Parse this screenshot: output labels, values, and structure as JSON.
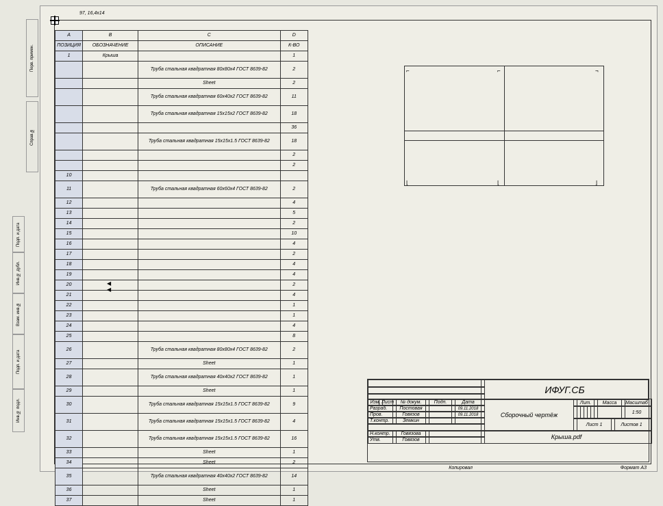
{
  "dim_label": "97, 16,4x14",
  "columns": {
    "a": "A",
    "b": "B",
    "c": "C",
    "d": "D"
  },
  "headers": {
    "poz": "ПОЗИЦИЯ",
    "oboz": "ОБОЗНАЧЕНИЕ",
    "desc": "ОПИСАНИЕ",
    "qty": "К-ВО"
  },
  "rows": [
    {
      "n": "1",
      "b": "Крыша",
      "c": "",
      "d": "1"
    },
    {
      "n": "",
      "b": "",
      "c": "Труба стальная квадратная 80х80х4 ГОСТ 8639-82",
      "d": "2"
    },
    {
      "n": "",
      "b": "",
      "c": "Sheet",
      "d": "2"
    },
    {
      "n": "",
      "b": "",
      "c": "Труба стальная квадратная 60х40х2 ГОСТ 8639-82",
      "d": "11"
    },
    {
      "n": "",
      "b": "",
      "c": "Труба стальная квадратная 15х15х2 ГОСТ 8639-82",
      "d": "18"
    },
    {
      "n": "",
      "b": "",
      "c": "",
      "d": "36"
    },
    {
      "n": "",
      "b": "",
      "c": "Труба стальная квадратная 15х15х1.5 ГОСТ 8639-82",
      "d": "18"
    },
    {
      "n": "",
      "b": "",
      "c": "",
      "d": "2"
    },
    {
      "n": "",
      "b": "",
      "c": "",
      "d": "2"
    },
    {
      "n": "10",
      "b": "",
      "c": "",
      "d": ""
    },
    {
      "n": "11",
      "b": "",
      "c": "Труба стальная квадратная 60х60х4 ГОСТ 8639-82",
      "d": "2"
    },
    {
      "n": "12",
      "b": "",
      "c": "",
      "d": "4"
    },
    {
      "n": "13",
      "b": "",
      "c": "",
      "d": "5"
    },
    {
      "n": "14",
      "b": "",
      "c": "",
      "d": "2"
    },
    {
      "n": "15",
      "b": "",
      "c": "",
      "d": "10"
    },
    {
      "n": "16",
      "b": "",
      "c": "",
      "d": "4"
    },
    {
      "n": "17",
      "b": "",
      "c": "",
      "d": "2"
    },
    {
      "n": "18",
      "b": "",
      "c": "",
      "d": "4"
    },
    {
      "n": "19",
      "b": "",
      "c": "",
      "d": "4"
    },
    {
      "n": "20",
      "b": "",
      "c": "",
      "d": "2"
    },
    {
      "n": "21",
      "b": "",
      "c": "",
      "d": "4"
    },
    {
      "n": "22",
      "b": "",
      "c": "",
      "d": "1"
    },
    {
      "n": "23",
      "b": "",
      "c": "",
      "d": "1"
    },
    {
      "n": "24",
      "b": "",
      "c": "",
      "d": "4"
    },
    {
      "n": "25",
      "b": "",
      "c": "",
      "d": "8"
    },
    {
      "n": "26",
      "b": "",
      "c": "Труба стальная квадратная 80х80х4 ГОСТ 8639-82",
      "d": "2"
    },
    {
      "n": "27",
      "b": "",
      "c": "Sheet",
      "d": "1"
    },
    {
      "n": "28",
      "b": "",
      "c": "Труба стальная квадратная 40х40х2 ГОСТ 8639-82",
      "d": "1"
    },
    {
      "n": "29",
      "b": "",
      "c": "Sheet",
      "d": "1"
    },
    {
      "n": "30",
      "b": "",
      "c": "Труба стальная квадратная 15х15х1.5 ГОСТ 8639-82",
      "d": "9"
    },
    {
      "n": "31",
      "b": "",
      "c": "Труба стальная квадратная 15х15х1.5 ГОСТ 8639-82",
      "d": "4"
    },
    {
      "n": "32",
      "b": "",
      "c": "Труба стальная квадратная 15х15х1.5 ГОСТ 8639-82",
      "d": "16"
    },
    {
      "n": "33",
      "b": "",
      "c": "Sheet",
      "d": "1"
    },
    {
      "n": "34",
      "b": "",
      "c": "Sheet",
      "d": "2"
    },
    {
      "n": "35",
      "b": "",
      "c": "Труба стальная квадратная 40х40х2 ГОСТ 8639-82",
      "d": "14"
    },
    {
      "n": "36",
      "b": "",
      "c": "Sheet",
      "d": "1"
    },
    {
      "n": "37",
      "b": "",
      "c": "Sheet",
      "d": "1"
    }
  ],
  "titleblock": {
    "code": "ИФУГ.СБ",
    "type": "Сборочный чертёж",
    "lit": "Лит.",
    "massa": "Масса",
    "mashtab": "Масштаб",
    "mashtab_val": "1:50",
    "list": "Лист 1",
    "listov": "Листов 1",
    "file": "Крыша.pdf",
    "format": "Формат A3",
    "kopiroval": "Копировал",
    "roles": {
      "izm": "Изм.",
      "list": "Лист",
      "ndoc": "№ докум.",
      "podp": "Подп.",
      "data": "Дата",
      "razrab": "Разраб.",
      "razrab_name": "Постовая",
      "razrab_date": "09.11.2018",
      "prov": "Пров.",
      "prov_name": "Говязов",
      "prov_date": "09.11.2018",
      "tkontr": "Т.контр.",
      "tkontr_name": "Земкин",
      "nkontr": "Н.контр.",
      "nkontr_name": "Говязова",
      "utv": "Утв.",
      "utv_name": "Говязов"
    }
  },
  "sideboxes": [
    "Инв.№ подл.",
    "Подп. и дата",
    "Взам. инв.№",
    "Инв.№ дубл.",
    "Подп. и дата",
    "Справ.№",
    "Перв. примен."
  ]
}
